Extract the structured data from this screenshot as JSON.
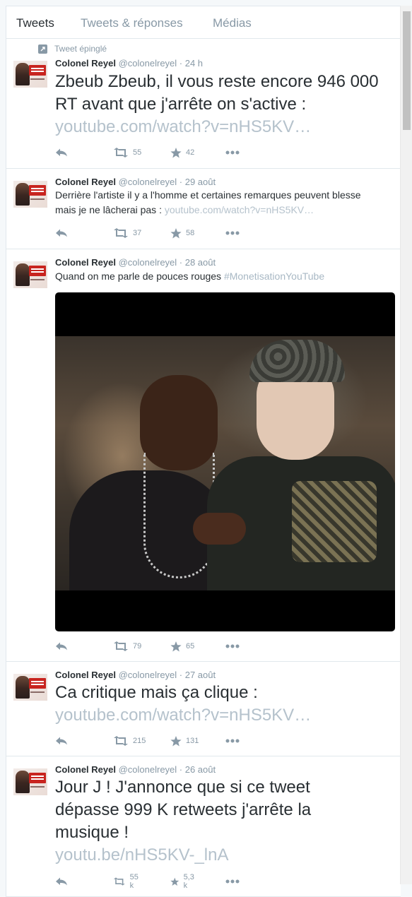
{
  "tabs": [
    {
      "label": "Tweets",
      "active": true
    },
    {
      "label": "Tweets & réponses",
      "active": false
    },
    {
      "label": "Médias",
      "active": false
    }
  ],
  "pinned_label": "Tweet épinglé",
  "tweets": [
    {
      "name": "Colonel Reyel",
      "handle": "@colonelreyel",
      "time": "· 24 h",
      "text": "Zbeub Zbeub, il vous reste encore 946 000 RT avant que j'arrête on s'active :",
      "link": "youtube.com/watch?v=nHS5KV…",
      "retweets": "55",
      "favorites": "42"
    },
    {
      "name": "Colonel Reyel",
      "handle": "@colonelreyel",
      "time": "· 29 août",
      "text_line1": "Derrière l'artiste il y a l'homme et certaines remarques peuvent blesse",
      "text_line2": "mais je ne lâcherai pas :",
      "link": "youtube.com/watch?v=nHS5KV…",
      "retweets": "37",
      "favorites": "58"
    },
    {
      "name": "Colonel Reyel",
      "handle": "@colonelreyel",
      "time": "· 28 août",
      "text": "Quand on me parle de pouces rouges",
      "hashtag": "#MonetisationYouTube",
      "retweets": "79",
      "favorites": "65"
    },
    {
      "name": "Colonel Reyel",
      "handle": "@colonelreyel",
      "time": "· 27 août",
      "text": "Ca critique mais ça clique :",
      "link": "youtube.com/watch?v=nHS5KV…",
      "retweets": "215",
      "favorites": "131"
    },
    {
      "name": "Colonel Reyel",
      "handle": "@colonelreyel",
      "time": "· 26 août",
      "text": "Jour J ! J'annonce que si ce tweet dépasse 999 K retweets j'arrête la musique !",
      "link": "youtu.be/nHS5KV-_lnA",
      "retweets": "55 k",
      "favorites": "5,3 k"
    }
  ],
  "icons": {
    "reply": "reply-icon",
    "retweet": "retweet-icon",
    "favorite": "star-icon",
    "more": "more-icon",
    "pin": "pin-icon"
  },
  "colors": {
    "text": "#292f33",
    "muted": "#8899a6",
    "link": "#b5c2cc",
    "border": "#e1e8ed",
    "background": "#f5f8fa"
  }
}
